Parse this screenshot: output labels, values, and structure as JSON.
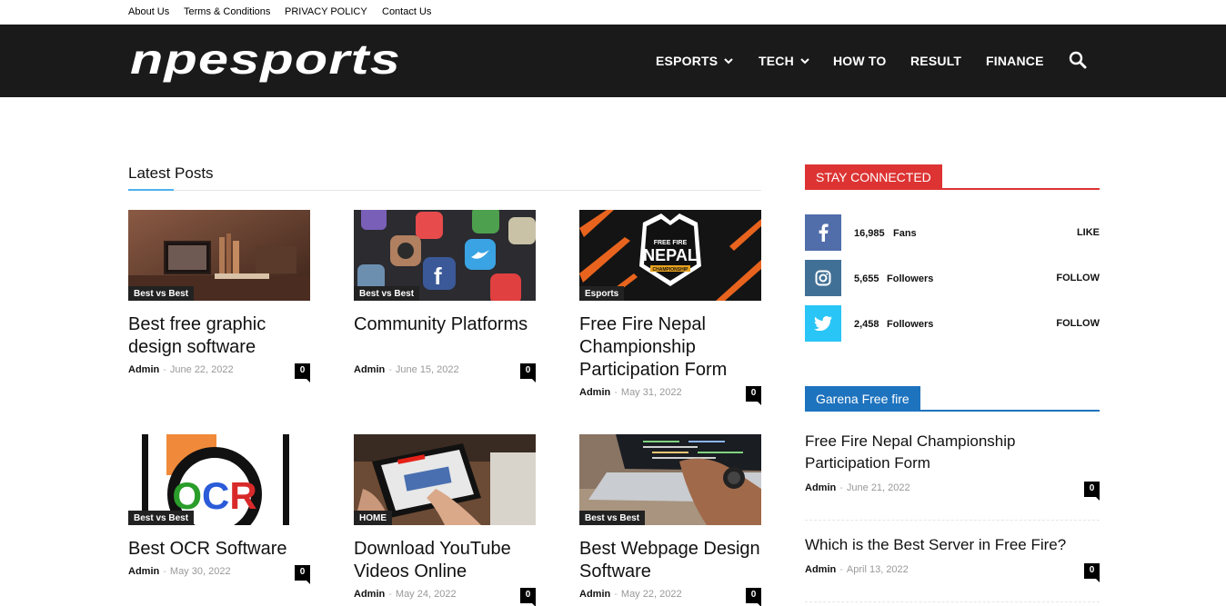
{
  "topbar": {
    "links": [
      "About Us",
      "Terms & Conditions",
      "PRIVACY POLICY",
      "Contact Us"
    ]
  },
  "header": {
    "logo_text": "npesports",
    "nav": [
      {
        "label": "ESPORTS",
        "dropdown": true
      },
      {
        "label": "TECH",
        "dropdown": true
      },
      {
        "label": "HOW TO",
        "dropdown": false
      },
      {
        "label": "RESULT",
        "dropdown": false
      },
      {
        "label": "FINANCE",
        "dropdown": false
      }
    ],
    "search_icon": "search-icon"
  },
  "latest": {
    "title": "Latest Posts",
    "posts": [
      {
        "category": "Best vs Best",
        "title": "Best free graphic design software",
        "author": "Admin",
        "date": "June 22, 2022",
        "comments": "0"
      },
      {
        "category": "Best vs Best",
        "title": "Community Platforms",
        "author": "Admin",
        "date": "June 15, 2022",
        "comments": "0"
      },
      {
        "category": "Esports",
        "title": "Free Fire Nepal Championship Participation Form",
        "author": "Admin",
        "date": "May 31, 2022",
        "comments": "0"
      },
      {
        "category": "Best vs Best",
        "title": "Best OCR Software",
        "author": "Admin",
        "date": "May 30, 2022",
        "comments": "0"
      },
      {
        "category": "HOME",
        "title": "Download YouTube Videos Online",
        "author": "Admin",
        "date": "May 24, 2022",
        "comments": "0"
      },
      {
        "category": "Best vs Best",
        "title": "Best Webpage Design Software",
        "author": "Admin",
        "date": "May 22, 2022",
        "comments": "0"
      }
    ],
    "image_text": {
      "ocr": "OCR",
      "freefire_top": "FREE FIRE",
      "freefire_main": "NEPAL",
      "freefire_sub": "CHAMPIONSHIP"
    }
  },
  "sidebar": {
    "stay_connected": {
      "title": "STAY CONNECTED",
      "color": "#dd3333",
      "rows": [
        {
          "network": "facebook",
          "icon": "facebook-icon",
          "count": "16,985",
          "unit": "Fans",
          "action": "LIKE",
          "color": "#516eab"
        },
        {
          "network": "instagram",
          "icon": "instagram-icon",
          "count": "5,655",
          "unit": "Followers",
          "action": "FOLLOW",
          "color": "#417096"
        },
        {
          "network": "twitter",
          "icon": "twitter-icon",
          "count": "2,458",
          "unit": "Followers",
          "action": "FOLLOW",
          "color": "#29c5f6"
        }
      ]
    },
    "garena": {
      "title": "Garena Free fire",
      "color": "#1e73be",
      "posts": [
        {
          "title": "Free Fire Nepal Championship Participation Form",
          "author": "Admin",
          "date": "June 21, 2022",
          "comments": "0"
        },
        {
          "title": "Which is the Best Server in Free Fire?",
          "author": "Admin",
          "date": "April 13, 2022",
          "comments": "0"
        }
      ]
    }
  }
}
